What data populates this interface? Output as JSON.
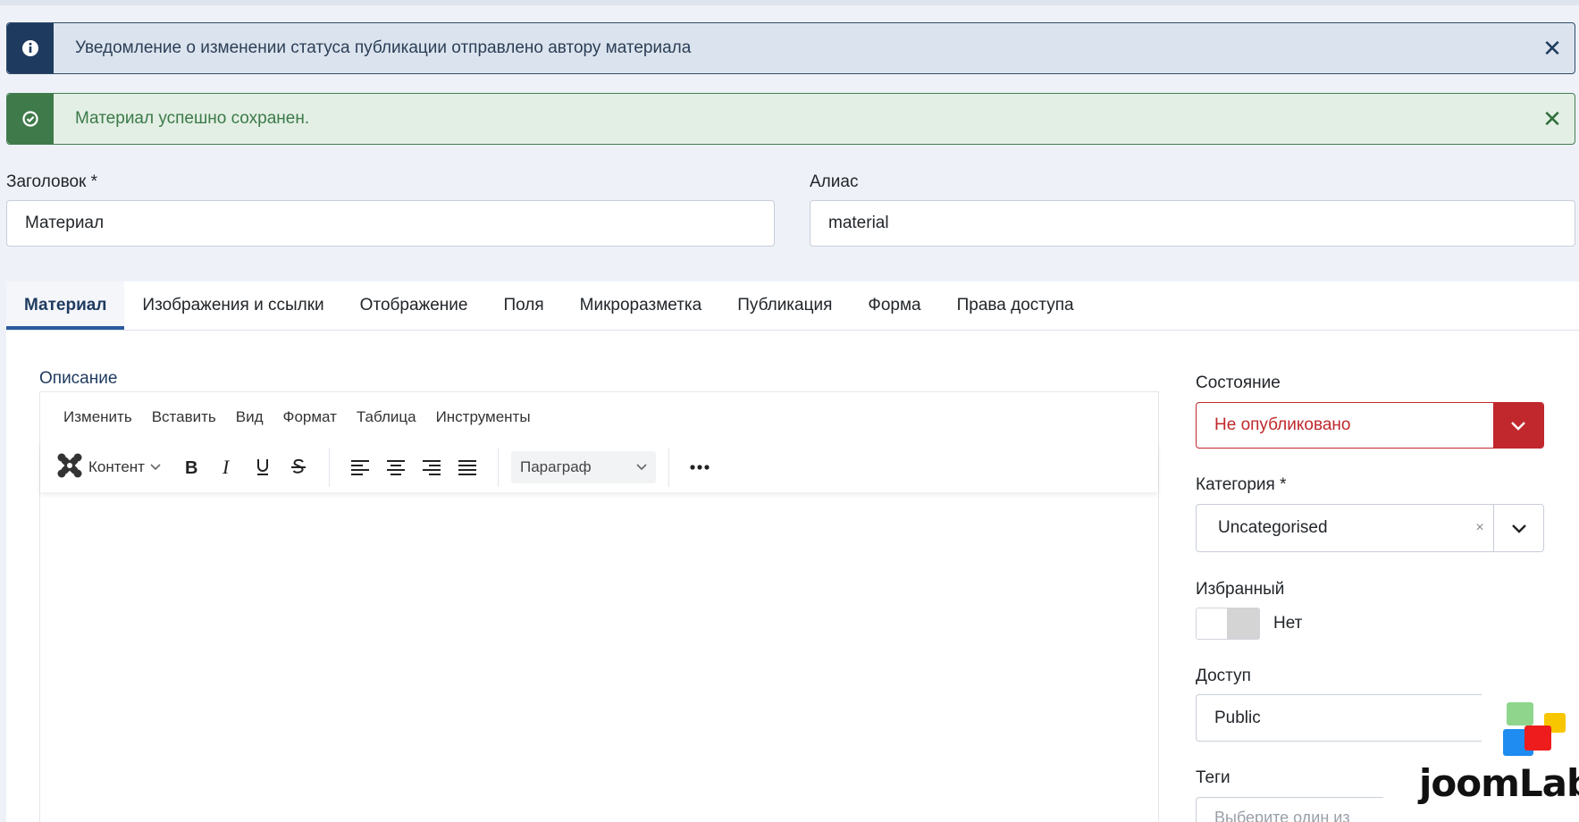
{
  "alerts": {
    "info": {
      "message": "Уведомление о изменении статуса публикации отправлено автору материала",
      "close": "✕"
    },
    "success": {
      "message": "Материал успешно сохранен.",
      "close": "✕"
    }
  },
  "form": {
    "title_label": "Заголовок *",
    "title_value": "Материал",
    "alias_label": "Алиас",
    "alias_value": "material"
  },
  "tabs": [
    {
      "label": "Материал",
      "active": true
    },
    {
      "label": "Изображения и ссылки"
    },
    {
      "label": "Отображение"
    },
    {
      "label": "Поля"
    },
    {
      "label": "Микроразметка"
    },
    {
      "label": "Публикация"
    },
    {
      "label": "Форма"
    },
    {
      "label": "Права доступа"
    }
  ],
  "editor": {
    "label": "Описание",
    "menu": [
      "Изменить",
      "Вставить",
      "Вид",
      "Формат",
      "Таблица",
      "Инструменты"
    ],
    "content_button": "Контент",
    "paragraph_select": "Параграф",
    "icons": [
      "joomla-icon",
      "bold-icon",
      "italic-icon",
      "underline-icon",
      "strikethrough-icon",
      "align-left-icon",
      "align-center-icon",
      "align-right-icon",
      "align-justify-icon",
      "more-icon"
    ]
  },
  "sidebar": {
    "status_label": "Состояние",
    "status_value": "Не опубликовано",
    "category_label": "Категория *",
    "category_value": "Uncategorised",
    "category_clear": "×",
    "featured_label": "Избранный",
    "featured_value": "Нет",
    "access_label": "Доступ",
    "access_value": "Public",
    "tags_label": "Теги",
    "tags_placeholder": "Выберите один из"
  },
  "watermark": {
    "text": "joomLab"
  },
  "colors": {
    "info_strip": "#1f3a5f",
    "success_strip": "#3f7a4a",
    "danger": "#c0282d",
    "tab_active": "#2a5a9c"
  }
}
